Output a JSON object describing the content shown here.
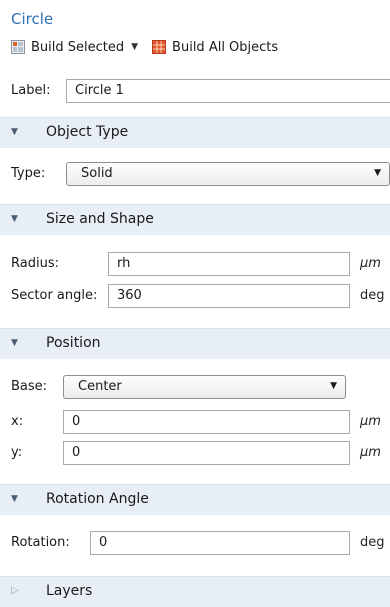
{
  "title": "Circle",
  "toolbar": {
    "build_selected": "Build Selected",
    "build_all": "Build All Objects"
  },
  "label_row": {
    "label": "Label:",
    "value": "Circle 1"
  },
  "sections": {
    "object_type": "Object Type",
    "size_shape": "Size and Shape",
    "position": "Position",
    "rotation": "Rotation Angle",
    "layers": "Layers"
  },
  "object_type": {
    "label": "Type:",
    "value": "Solid"
  },
  "size_shape": {
    "radius_label": "Radius:",
    "radius_value": "rh",
    "radius_unit": "µm",
    "sector_label": "Sector angle:",
    "sector_value": "360",
    "sector_unit": "deg"
  },
  "position": {
    "base_label": "Base:",
    "base_value": "Center",
    "x_label": "x:",
    "x_value": "0",
    "x_unit": "µm",
    "y_label": "y:",
    "y_value": "0",
    "y_unit": "µm"
  },
  "rotation": {
    "label": "Rotation:",
    "value": "0",
    "unit": "deg"
  },
  "icons": {
    "build_selected": "build-selected-icon",
    "build_all": "build-all-icon",
    "expanded": "triangle-down-icon",
    "collapsed": "triangle-right-icon"
  }
}
